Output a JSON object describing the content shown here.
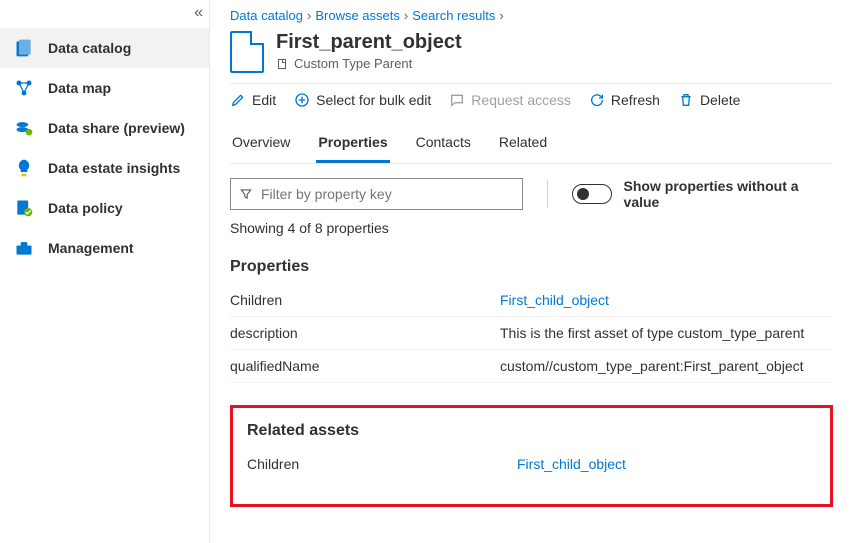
{
  "sidebar": {
    "items": [
      {
        "label": "Data catalog"
      },
      {
        "label": "Data map"
      },
      {
        "label": "Data share (preview)"
      },
      {
        "label": "Data estate insights"
      },
      {
        "label": "Data policy"
      },
      {
        "label": "Management"
      }
    ]
  },
  "breadcrumb": {
    "items": [
      "Data catalog",
      "Browse assets",
      "Search results"
    ]
  },
  "asset": {
    "title": "First_parent_object",
    "subtype": "Custom Type Parent"
  },
  "toolbar": {
    "edit": "Edit",
    "select_bulk": "Select for bulk edit",
    "request_access": "Request access",
    "refresh": "Refresh",
    "delete": "Delete"
  },
  "tabs": {
    "overview": "Overview",
    "properties": "Properties",
    "contacts": "Contacts",
    "related": "Related"
  },
  "filter": {
    "placeholder": "Filter by property key",
    "toggle_label": "Show properties without a value"
  },
  "showing_text": "Showing 4 of 8 properties",
  "sections": {
    "properties_head": "Properties",
    "related_head": "Related assets"
  },
  "properties": [
    {
      "key": "Children",
      "value": "First_child_object",
      "is_link": true
    },
    {
      "key": "description",
      "value": "This is the first asset of type custom_type_parent",
      "is_link": false
    },
    {
      "key": "qualifiedName",
      "value": "custom//custom_type_parent:First_parent_object",
      "is_link": false
    }
  ],
  "related": [
    {
      "key": "Children",
      "value": "First_child_object"
    }
  ]
}
